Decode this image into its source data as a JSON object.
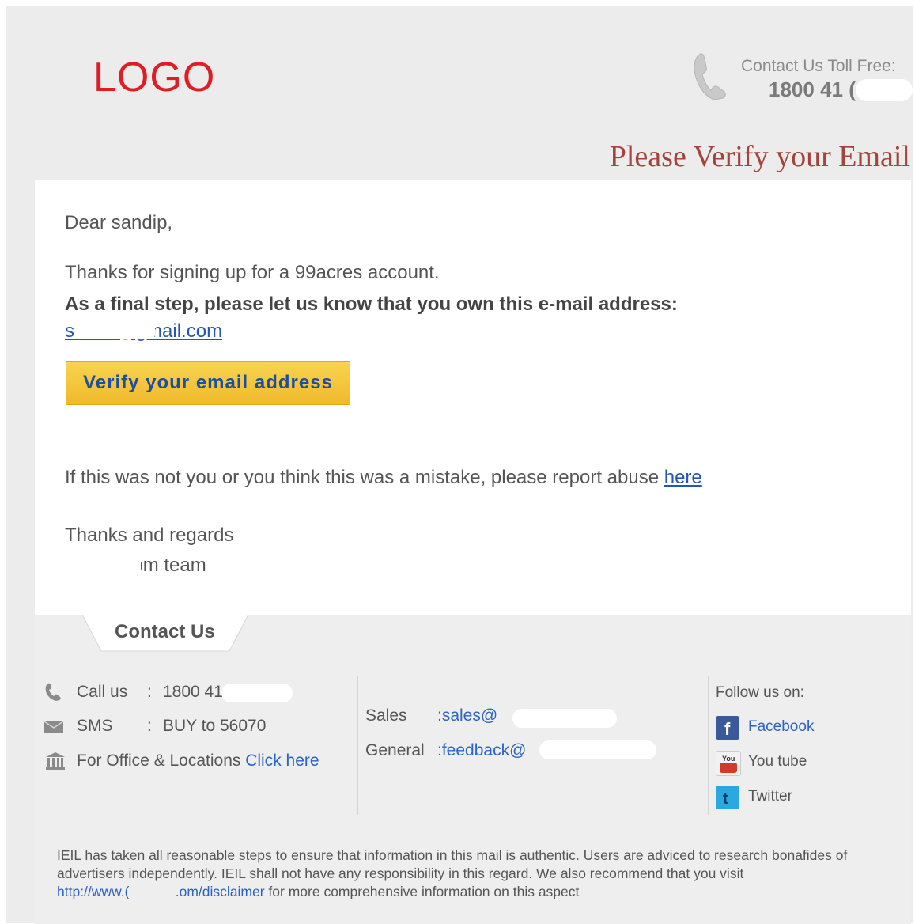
{
  "header": {
    "logo_text": "LOGO",
    "toll_label": "Contact Us Toll Free:",
    "toll_number": "1800 41 ("
  },
  "page_heading": "Please Verify your Email",
  "email": {
    "greeting": "Dear sandip,",
    "thanks_line": "Thanks for signing up for a 99acres account.",
    "final_step": "As a final step, please let us know that you own this e-mail address:",
    "address_link": "s        @gmail.com",
    "verify_button": "Verify your email address",
    "abuse_text": "If this was not you or you think this was a mistake, please report abuse ",
    "abuse_link": "here",
    "signoff": "Thanks and regards",
    "team": "          .com team"
  },
  "footer": {
    "tab_label": "Contact Us",
    "call_label": "Call us",
    "call_sep": ":",
    "call_value": "1800 41",
    "sms_label": "SMS",
    "sms_sep": ":",
    "sms_value": "BUY to 56070",
    "office_text": "For Office & Locations",
    "office_link": "Click here",
    "sales_label": "Sales",
    "sales_value": ":sales@",
    "general_label": "General",
    "general_value": ":feedback@",
    "follow_label": "Follow us on:",
    "social": [
      {
        "name": "Facebook",
        "icon": "facebook-icon",
        "color": "#3b5998"
      },
      {
        "name": "You tube",
        "icon": "youtube-icon",
        "color": "#d33a2c"
      },
      {
        "name": "Twitter",
        "icon": "twitter-icon",
        "color": "#2aa9e0"
      }
    ],
    "disclaimer_1": "IEIL has taken all reasonable steps to ensure that information in this mail is authentic. Users are adviced to research bonafides of advertisers independently. IEIL shall not have any responsibility in this regard. We also recommend that you visit ",
    "disclaimer_link": "http://www.(            .om/disclaimer",
    "disclaimer_2": " for more comprehensive information on this aspect"
  }
}
